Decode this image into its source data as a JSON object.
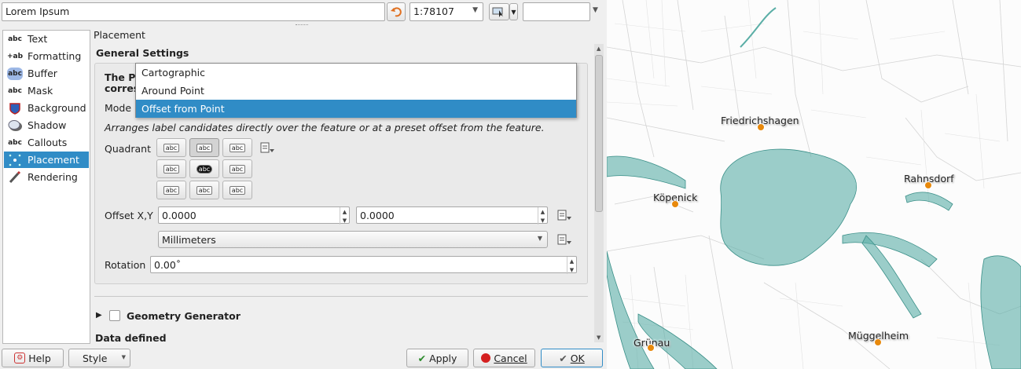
{
  "toolbar": {
    "layer_name": "Lorem Ipsum",
    "scale": "1:78107",
    "scale_field_extra": ""
  },
  "sidebar": {
    "items": [
      {
        "label": "Text",
        "icon": "abc"
      },
      {
        "label": "Formatting",
        "icon": "+ab"
      },
      {
        "label": "Buffer",
        "icon": "abc"
      },
      {
        "label": "Mask",
        "icon": "abc"
      },
      {
        "label": "Background",
        "icon": "shield"
      },
      {
        "label": "Shadow",
        "icon": "shadow"
      },
      {
        "label": "Callouts",
        "icon": "abc"
      },
      {
        "label": "Placement",
        "icon": "placement"
      },
      {
        "label": "Rendering",
        "icon": "brush"
      }
    ],
    "selected": "Placement"
  },
  "placement": {
    "heading": "Placement",
    "general_settings": "General Settings",
    "info_partial_line1": "The P",
    "info_partial_line2": "corres",
    "mode_label": "Mode",
    "mode_options": [
      "Cartographic",
      "Around Point",
      "Offset from Point"
    ],
    "mode_selected": "Offset from Point",
    "description": "Arranges label candidates directly over the feature or at a preset offset from the feature.",
    "quadrant_label": "Quadrant",
    "quadrant_selected": "top-center",
    "quadrant_glyph": "abc",
    "offset_label": "Offset X,Y",
    "offset_x": "0.0000",
    "offset_y": "0.0000",
    "units": "Millimeters",
    "rotation_label": "Rotation",
    "rotation": "0.00˚",
    "geometry_generator": "Geometry Generator",
    "data_defined": "Data defined"
  },
  "buttons": {
    "help": "Help",
    "style": "Style",
    "apply": "Apply",
    "cancel": "Cancel",
    "ok": "OK"
  },
  "map": {
    "places": [
      "Friedrichshagen",
      "Rahnsdorf",
      "Köpenick",
      "Grünau",
      "Müggelheim"
    ],
    "water_color": "#5aaea6",
    "point_color": "#e8890c"
  }
}
